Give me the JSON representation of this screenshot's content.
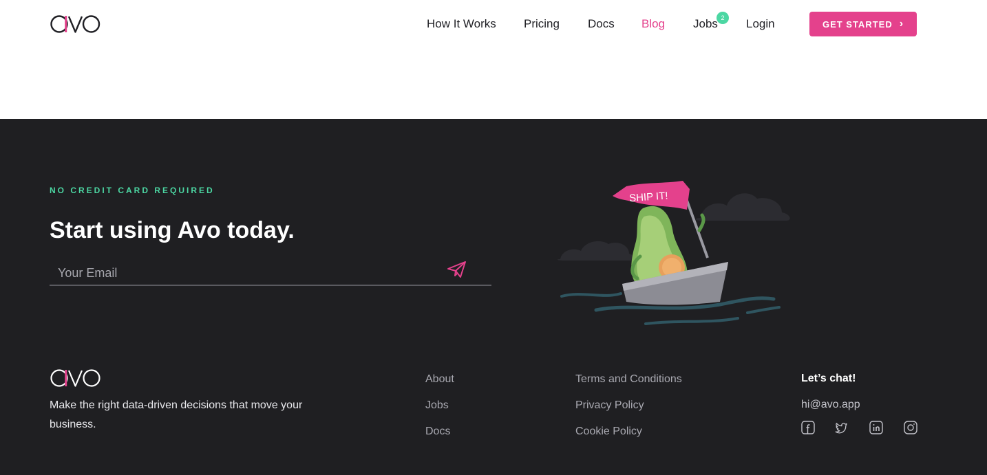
{
  "header": {
    "logo_text": "avo",
    "nav": [
      {
        "label": "How It Works"
      },
      {
        "label": "Pricing"
      },
      {
        "label": "Docs"
      },
      {
        "label": "Blog"
      },
      {
        "label": "Jobs",
        "badge": "2"
      },
      {
        "label": "Login"
      }
    ],
    "active_nav": "Blog",
    "cta_label": "GET STARTED",
    "cta_icon": "chevron-right-icon"
  },
  "signup": {
    "eyebrow": "NO CREDIT CARD REQUIRED",
    "headline": "Start using Avo today.",
    "email_placeholder": "Your Email",
    "email_value": "",
    "send_icon": "paper-plane-icon",
    "illustration_flag_text": "SHIP IT!"
  },
  "footer": {
    "logo_text": "avo",
    "tagline": "Make the right data-driven decisions that move your business.",
    "col1": [
      "About",
      "Jobs",
      "Docs"
    ],
    "col2": [
      "Terms and Conditions",
      "Privacy Policy",
      "Cookie Policy"
    ],
    "contact_title": "Let’s chat!",
    "contact_email": "hi@avo.app",
    "social_icons": [
      "facebook-icon",
      "twitter-icon",
      "linkedin-icon",
      "instagram-icon"
    ]
  },
  "colors": {
    "brand_pink": "#e4418c",
    "accent_green": "#4cd7a3",
    "dark_bg": "#1f1f22",
    "nav_text": "#1f1f24"
  }
}
